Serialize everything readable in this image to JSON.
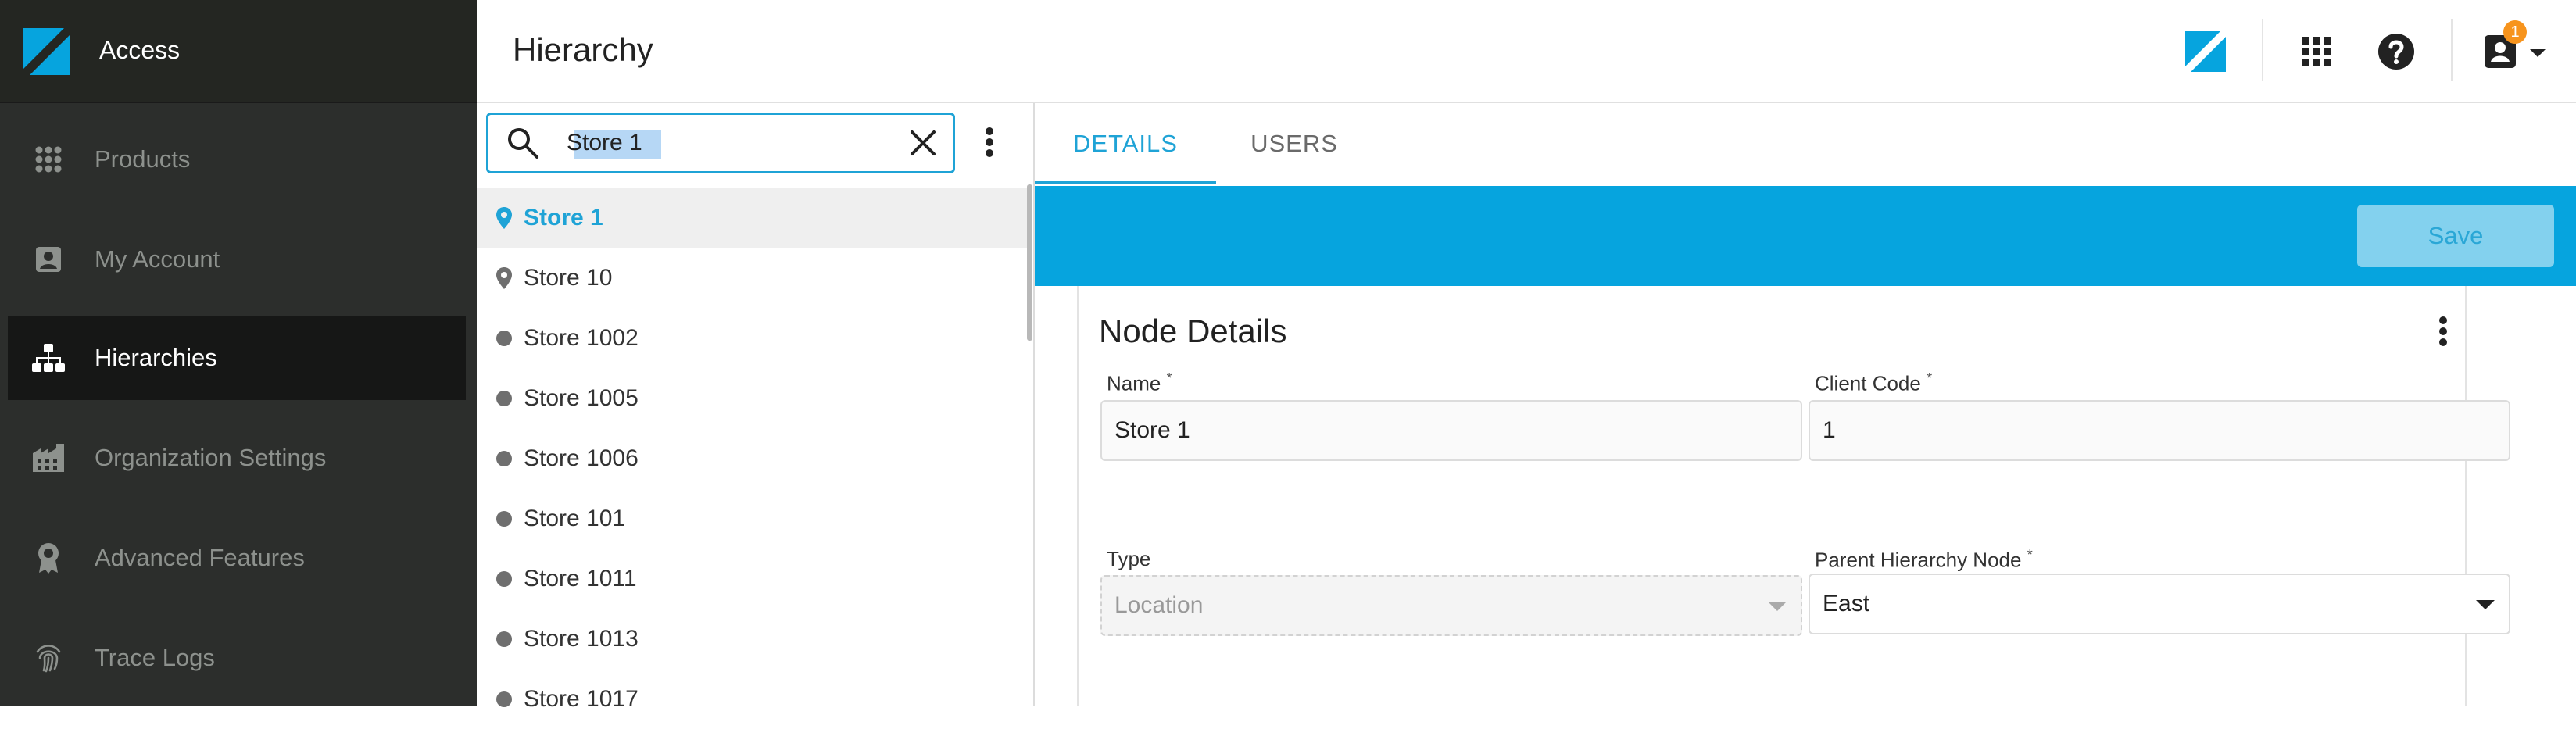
{
  "app": {
    "name": "Access",
    "page_title": "Hierarchy",
    "notification_count": "1",
    "brand_color": "#06a4de"
  },
  "sidebar": {
    "items": [
      {
        "label": "Products",
        "icon": "apps-grid-icon"
      },
      {
        "label": "My Account",
        "icon": "account-box-icon"
      },
      {
        "label": "Hierarchies",
        "icon": "hierarchy-icon",
        "active": true
      },
      {
        "label": "Organization Settings",
        "icon": "building-icon"
      },
      {
        "label": "Advanced Features",
        "icon": "badge-icon"
      },
      {
        "label": "Trace Logs",
        "icon": "fingerprint-icon"
      }
    ]
  },
  "tree": {
    "search_value": "Store 1",
    "items": [
      {
        "label": "Store 1",
        "marker": "pin",
        "selected": true
      },
      {
        "label": "Store 10",
        "marker": "pin"
      },
      {
        "label": "Store 1002",
        "marker": "dot"
      },
      {
        "label": "Store 1005",
        "marker": "dot"
      },
      {
        "label": "Store 1006",
        "marker": "dot"
      },
      {
        "label": "Store 101",
        "marker": "dot"
      },
      {
        "label": "Store 1011",
        "marker": "dot"
      },
      {
        "label": "Store 1013",
        "marker": "dot"
      },
      {
        "label": "Store 1017",
        "marker": "dot"
      }
    ]
  },
  "details": {
    "tabs": [
      {
        "label": "DETAILS",
        "active": true
      },
      {
        "label": "USERS",
        "active": false
      }
    ],
    "save_label": "Save",
    "card_title": "Node Details",
    "fields": {
      "name_label": "Name",
      "name_value": "Store 1",
      "client_code_label": "Client Code",
      "client_code_value": "1",
      "type_label": "Type",
      "type_value": "Location",
      "parent_label": "Parent Hierarchy Node",
      "parent_value": "East",
      "required_mark": "*"
    }
  }
}
